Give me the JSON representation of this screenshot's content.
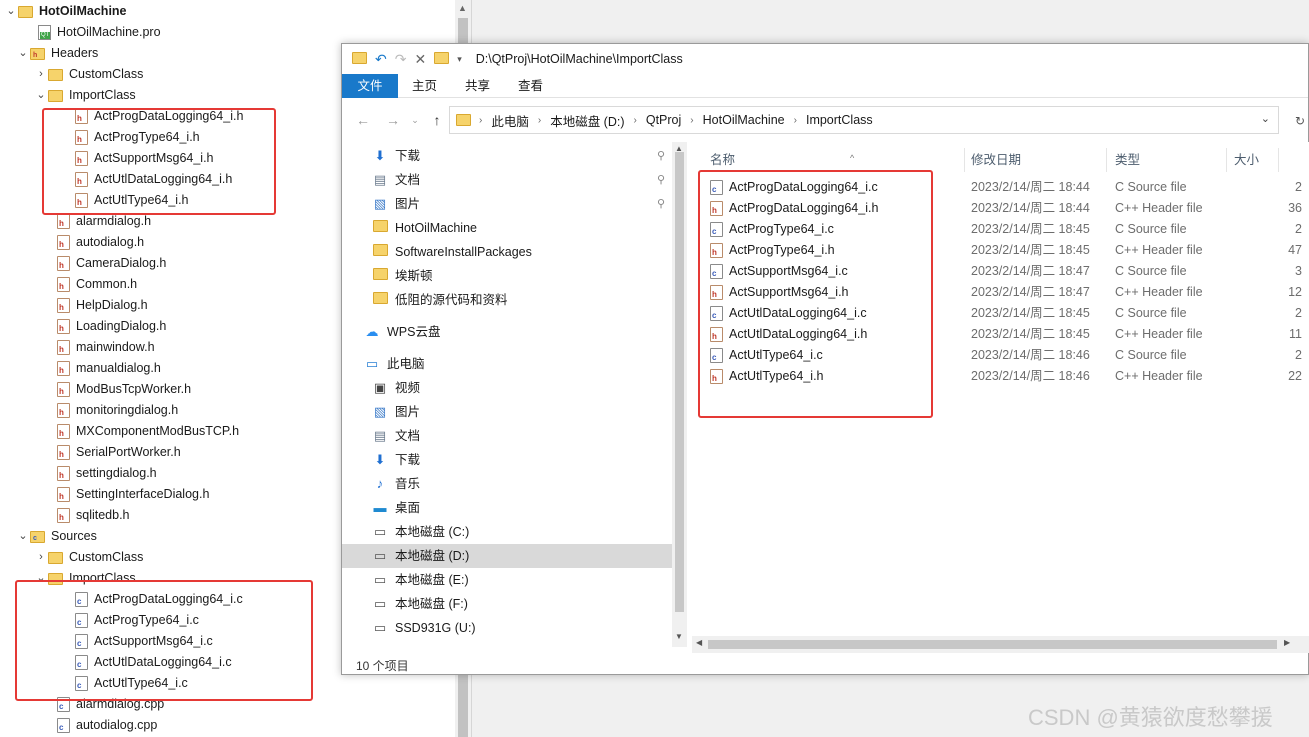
{
  "tree": {
    "project": "HotOilMachine",
    "pro_file": "HotOilMachine.pro",
    "headers_label": "Headers",
    "header_folders": [
      "CustomClass",
      "ImportClass"
    ],
    "import_headers": [
      "ActProgDataLogging64_i.h",
      "ActProgType64_i.h",
      "ActSupportMsg64_i.h",
      "ActUtlDataLogging64_i.h",
      "ActUtlType64_i.h"
    ],
    "headers": [
      "alarmdialog.h",
      "autodialog.h",
      "CameraDialog.h",
      "Common.h",
      "HelpDialog.h",
      "LoadingDialog.h",
      "mainwindow.h",
      "manualdialog.h",
      "ModBusTcpWorker.h",
      "monitoringdialog.h",
      "MXComponentModBusTCP.h",
      "SerialPortWorker.h",
      "settingdialog.h",
      "SettingInterfaceDialog.h",
      "sqlitedb.h"
    ],
    "sources_label": "Sources",
    "source_folders": [
      "CustomClass",
      "ImportClass"
    ],
    "import_sources": [
      "ActProgDataLogging64_i.c",
      "ActProgType64_i.c",
      "ActSupportMsg64_i.c",
      "ActUtlDataLogging64_i.c",
      "ActUtlType64_i.c"
    ],
    "sources": [
      "alarmdialog.cpp",
      "autodialog.cpp"
    ]
  },
  "explorer": {
    "title_path": "D:\\QtProj\\HotOilMachine\\ImportClass",
    "ribbon_tabs": [
      "文件",
      "主页",
      "共享",
      "查看"
    ],
    "breadcrumbs": [
      "此电脑",
      "本地磁盘 (D:)",
      "QtProj",
      "HotOilMachine",
      "ImportClass"
    ],
    "nav_quick": [
      {
        "label": "下载",
        "icon": "download-icon",
        "pinned": true
      },
      {
        "label": "文档",
        "icon": "document-icon",
        "pinned": true
      },
      {
        "label": "图片",
        "icon": "picture-icon",
        "pinned": true
      },
      {
        "label": "HotOilMachine",
        "icon": "folder-icon",
        "pinned": false
      },
      {
        "label": "SoftwareInstallPackages",
        "icon": "folder-icon",
        "pinned": false
      },
      {
        "label": "埃斯顿",
        "icon": "folder-icon",
        "pinned": false
      },
      {
        "label": "低阻的源代码和资料",
        "icon": "folder-icon",
        "pinned": false
      }
    ],
    "nav_cloud": "WPS云盘",
    "nav_pc": "此电脑",
    "nav_pc_items": [
      {
        "label": "视频",
        "icon": "video-icon"
      },
      {
        "label": "图片",
        "icon": "picture-icon"
      },
      {
        "label": "文档",
        "icon": "document-icon"
      },
      {
        "label": "下载",
        "icon": "download-icon"
      },
      {
        "label": "音乐",
        "icon": "music-icon"
      },
      {
        "label": "桌面",
        "icon": "desktop-icon"
      },
      {
        "label": "本地磁盘 (C:)",
        "icon": "drive-icon"
      },
      {
        "label": "本地磁盘 (D:)",
        "icon": "drive-icon",
        "selected": true
      },
      {
        "label": "本地磁盘 (E:)",
        "icon": "drive-icon"
      },
      {
        "label": "本地磁盘 (F:)",
        "icon": "drive-icon"
      },
      {
        "label": "SSD931G (U:)",
        "icon": "drive-icon"
      }
    ],
    "columns": [
      "名称",
      "修改日期",
      "类型",
      "大小"
    ],
    "files": [
      {
        "name": "ActProgDataLogging64_i.c",
        "date": "2023/2/14/周二 18:44",
        "type": "C Source file",
        "size": "2",
        "kind": "c"
      },
      {
        "name": "ActProgDataLogging64_i.h",
        "date": "2023/2/14/周二 18:44",
        "type": "C++ Header file",
        "size": "36",
        "kind": "h"
      },
      {
        "name": "ActProgType64_i.c",
        "date": "2023/2/14/周二 18:45",
        "type": "C Source file",
        "size": "2",
        "kind": "c"
      },
      {
        "name": "ActProgType64_i.h",
        "date": "2023/2/14/周二 18:45",
        "type": "C++ Header file",
        "size": "47",
        "kind": "h"
      },
      {
        "name": "ActSupportMsg64_i.c",
        "date": "2023/2/14/周二 18:47",
        "type": "C Source file",
        "size": "3",
        "kind": "c"
      },
      {
        "name": "ActSupportMsg64_i.h",
        "date": "2023/2/14/周二 18:47",
        "type": "C++ Header file",
        "size": "12",
        "kind": "h"
      },
      {
        "name": "ActUtlDataLogging64_i.c",
        "date": "2023/2/14/周二 18:45",
        "type": "C Source file",
        "size": "2",
        "kind": "c"
      },
      {
        "name": "ActUtlDataLogging64_i.h",
        "date": "2023/2/14/周二 18:45",
        "type": "C++ Header file",
        "size": "11",
        "kind": "h"
      },
      {
        "name": "ActUtlType64_i.c",
        "date": "2023/2/14/周二 18:46",
        "type": "C Source file",
        "size": "2",
        "kind": "c"
      },
      {
        "name": "ActUtlType64_i.h",
        "date": "2023/2/14/周二 18:46",
        "type": "C++ Header file",
        "size": "22",
        "kind": "h"
      }
    ],
    "status": "10 个项目"
  },
  "watermark": "CSDN @黄猿欲度愁攀援",
  "colors": {
    "accent": "#1979ca",
    "highlight": "#e53935",
    "selected_bg": "#d9d9d9"
  }
}
